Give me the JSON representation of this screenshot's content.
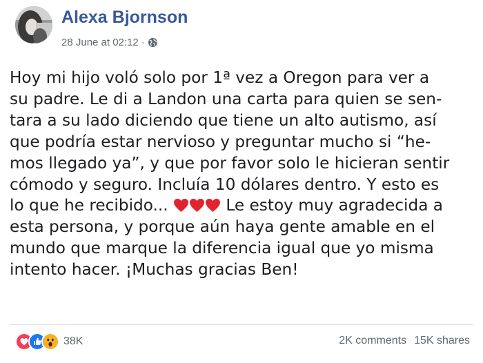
{
  "post": {
    "author": "Alexa Bjornson",
    "timestamp": "28 June at 02:12",
    "separator": "·",
    "privacy_icon": "globe-icon",
    "text_lines": [
      "Hoy mi hijo voló solo por 1ª vez a Oregon para ver a",
      "su padre. Le di a Landon una carta para quien se sen-",
      "tara a su lado diciendo que tiene un alto autismo, así",
      "que podría estar nervioso y preguntar mucho si “he-",
      "mos llegado ya”, y que por favor solo le hicieran sentir",
      "cómodo y seguro. Incluía 10 dólares dentro. Y esto es",
      "lo que he recibido... ",
      " Le estoy muy agradecida a",
      "esta persona, y porque aún haya gente amable en el",
      "mundo que marque la diferencia igual que yo misma",
      "intento hacer. ¡Muchas gracias Ben!"
    ],
    "emoji_hearts": [
      "heart-icon",
      "heart-icon",
      "heart-icon"
    ]
  },
  "footer": {
    "reaction_icons": [
      "love-reaction-icon",
      "like-reaction-icon",
      "wow-reaction-icon"
    ],
    "reaction_count": "38K",
    "comments": "2K comments",
    "shares": "15K shares"
  },
  "colors": {
    "author_link": "#385898",
    "meta_text": "#606770",
    "body_text": "#1c1e21",
    "heart_red": "#e0242e",
    "like_blue": "#1877f2",
    "wow_yellow": "#f7b125"
  }
}
